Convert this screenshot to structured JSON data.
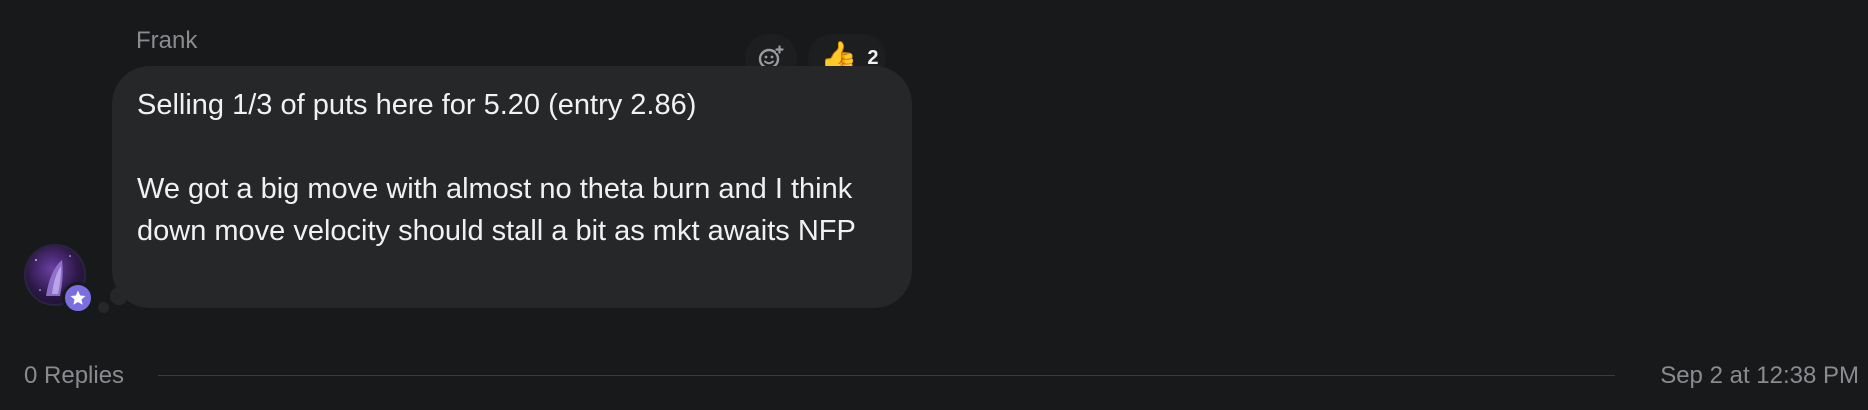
{
  "message": {
    "sender": "Frank",
    "paragraphs": [
      "Selling 1/3 of puts here for 5.20 (entry 2.86)",
      "We got a big move with almost no theta burn and I think down move velocity should stall a bit as mkt awaits NFP"
    ],
    "avatar_badge_icon": "star-icon",
    "reactions": [
      {
        "emoji": "👍",
        "icon": "thumbs-up-icon",
        "count": "2"
      }
    ],
    "add_reaction_icon": "add-reaction-icon"
  },
  "footer": {
    "replies": "0 Replies",
    "timestamp": "Sep 2 at 12:38 PM"
  },
  "colors": {
    "background": "#18191b",
    "bubble": "#262728",
    "text": "#f1f1f2",
    "muted": "#8a8b8e",
    "badge": "#7b6ee0"
  }
}
